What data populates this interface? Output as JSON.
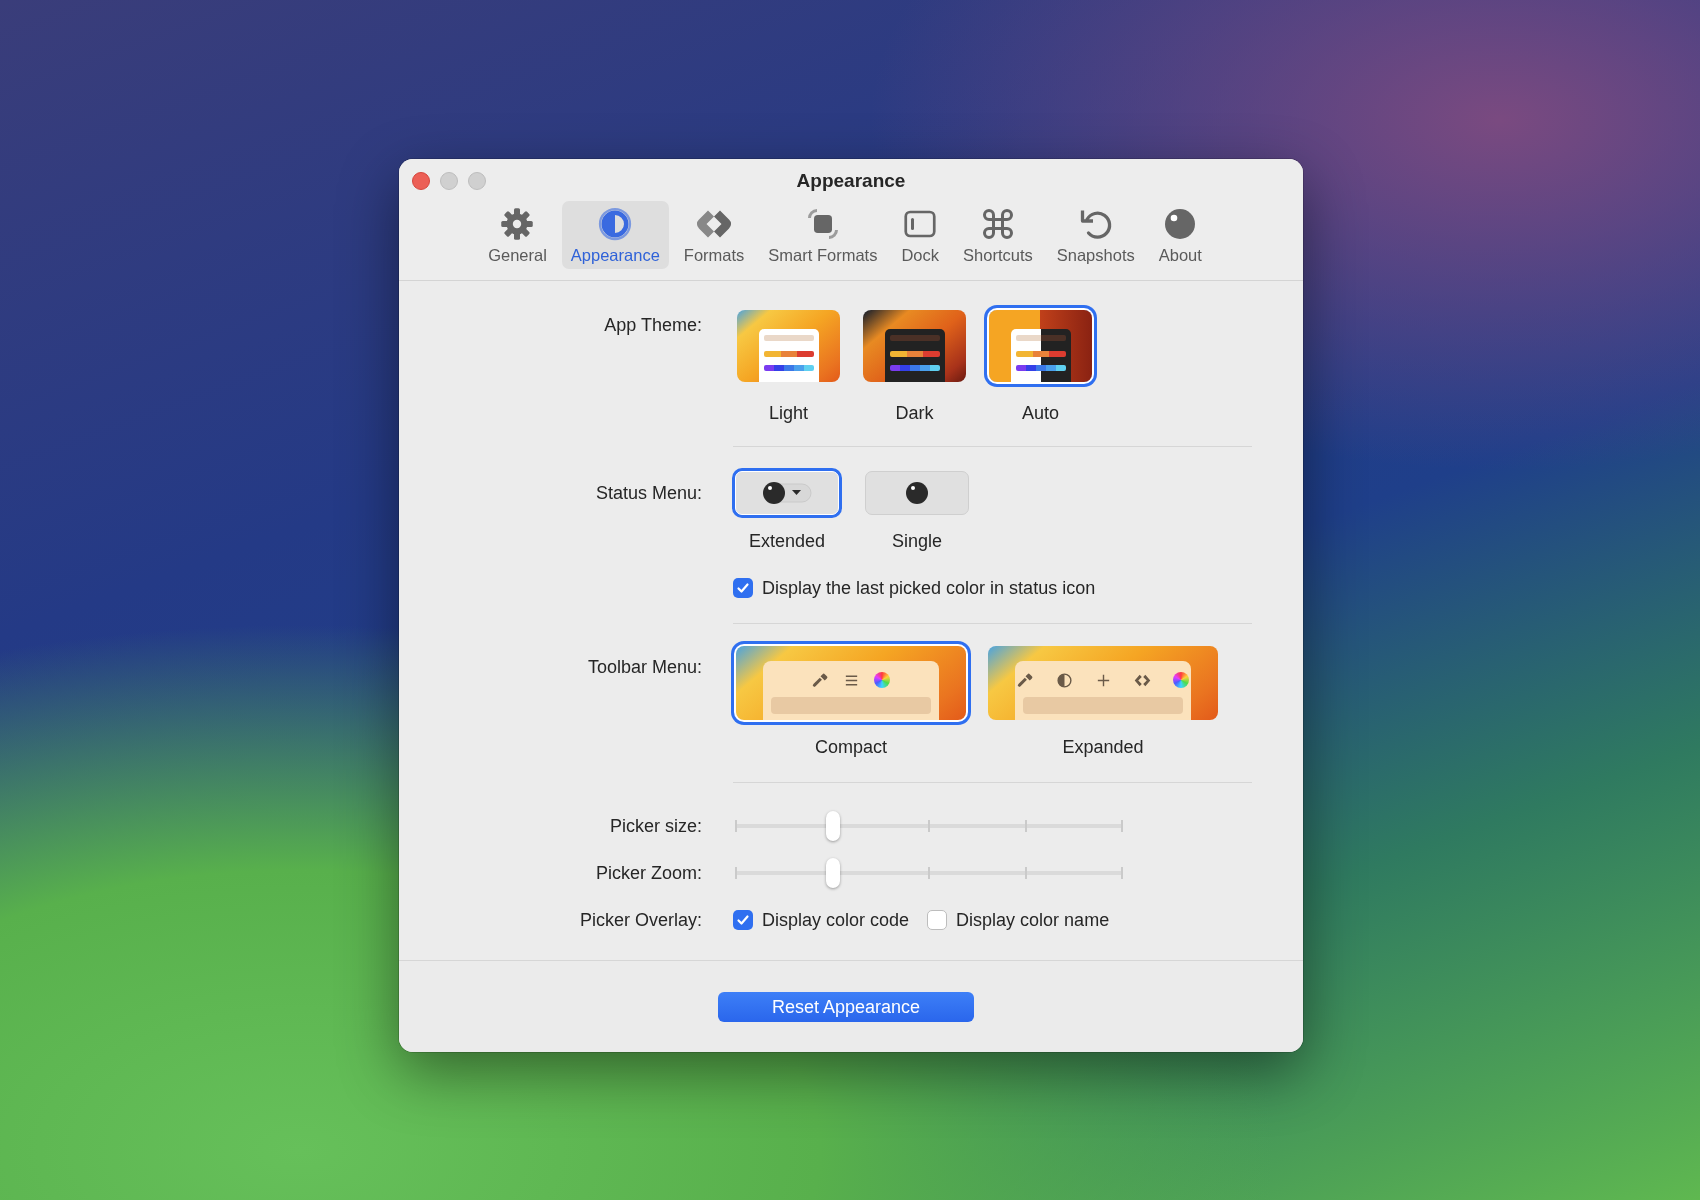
{
  "window": {
    "title": "Appearance"
  },
  "tabs": [
    {
      "label": "General",
      "selected": false
    },
    {
      "label": "Appearance",
      "selected": true
    },
    {
      "label": "Formats",
      "selected": false
    },
    {
      "label": "Smart Formats",
      "selected": false
    },
    {
      "label": "Dock",
      "selected": false
    },
    {
      "label": "Shortcuts",
      "selected": false
    },
    {
      "label": "Snapshots",
      "selected": false
    },
    {
      "label": "About",
      "selected": false
    }
  ],
  "app_theme": {
    "label": "App Theme:",
    "options": [
      {
        "kind": "light",
        "label": "Light",
        "selected": false
      },
      {
        "kind": "dark",
        "label": "Dark",
        "selected": false
      },
      {
        "kind": "auto",
        "label": "Auto",
        "selected": true
      }
    ]
  },
  "status_menu": {
    "label": "Status Menu:",
    "options": [
      {
        "kind": "extended",
        "label": "Extended",
        "selected": true
      },
      {
        "kind": "single",
        "label": "Single",
        "selected": false
      }
    ],
    "checkbox": {
      "label": "Display the last picked color in status icon",
      "checked": true
    }
  },
  "toolbar_menu": {
    "label": "Toolbar Menu:",
    "options": [
      {
        "kind": "compact",
        "label": "Compact",
        "selected": true
      },
      {
        "kind": "expanded",
        "label": "Expanded",
        "selected": false
      }
    ]
  },
  "sliders": [
    {
      "label": "Picker size:",
      "level": 0.25
    },
    {
      "label": "Picker Zoom:",
      "level": 0.25
    }
  ],
  "picker_overlay": {
    "label": "Picker Overlay:",
    "options": [
      {
        "label": "Display color code",
        "checked": true
      },
      {
        "label": "Display color name",
        "checked": false
      }
    ]
  },
  "reset_button": "Reset Appearance"
}
